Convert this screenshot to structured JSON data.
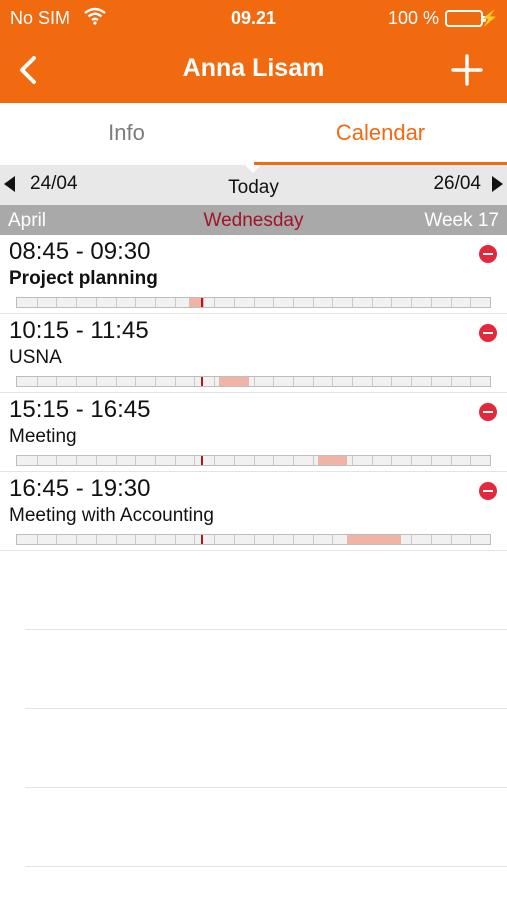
{
  "status_bar": {
    "carrier": "No SIM",
    "time": "09.21",
    "battery_percent": "100 %",
    "battery_level": 1.0,
    "battery_color": "#39d04a"
  },
  "nav": {
    "title": "Anna Lisam",
    "back_icon": "chevron-left-icon",
    "add_icon": "plus-icon"
  },
  "tabs": [
    {
      "label": "Info",
      "active": false
    },
    {
      "label": "Calendar",
      "active": true
    }
  ],
  "date_nav": {
    "prev_label": "24/04",
    "today_label": "Today",
    "next_label": "26/04"
  },
  "week_bar": {
    "month": "April",
    "weekday": "Wednesday",
    "week": "Week 17"
  },
  "timeline_now_hour": 9.35,
  "events": [
    {
      "time": "08:45 - 09:30",
      "title": "Project planning",
      "bold": true,
      "start": 8.75,
      "end": 9.5
    },
    {
      "time": "10:15 - 11:45",
      "title": "USNA",
      "bold": false,
      "start": 10.25,
      "end": 11.75
    },
    {
      "time": "15:15 - 16:45",
      "title": "Meeting",
      "bold": false,
      "start": 15.25,
      "end": 16.75
    },
    {
      "time": "16:45 - 19:30",
      "title": "Meeting with Accounting",
      "bold": false,
      "start": 16.75,
      "end": 19.5
    }
  ],
  "colors": {
    "accent": "#f26a0f",
    "weekday": "#a0142a",
    "remove": "#e3283c",
    "event_span": "#f0b4a6",
    "now_marker": "#b3151f"
  }
}
